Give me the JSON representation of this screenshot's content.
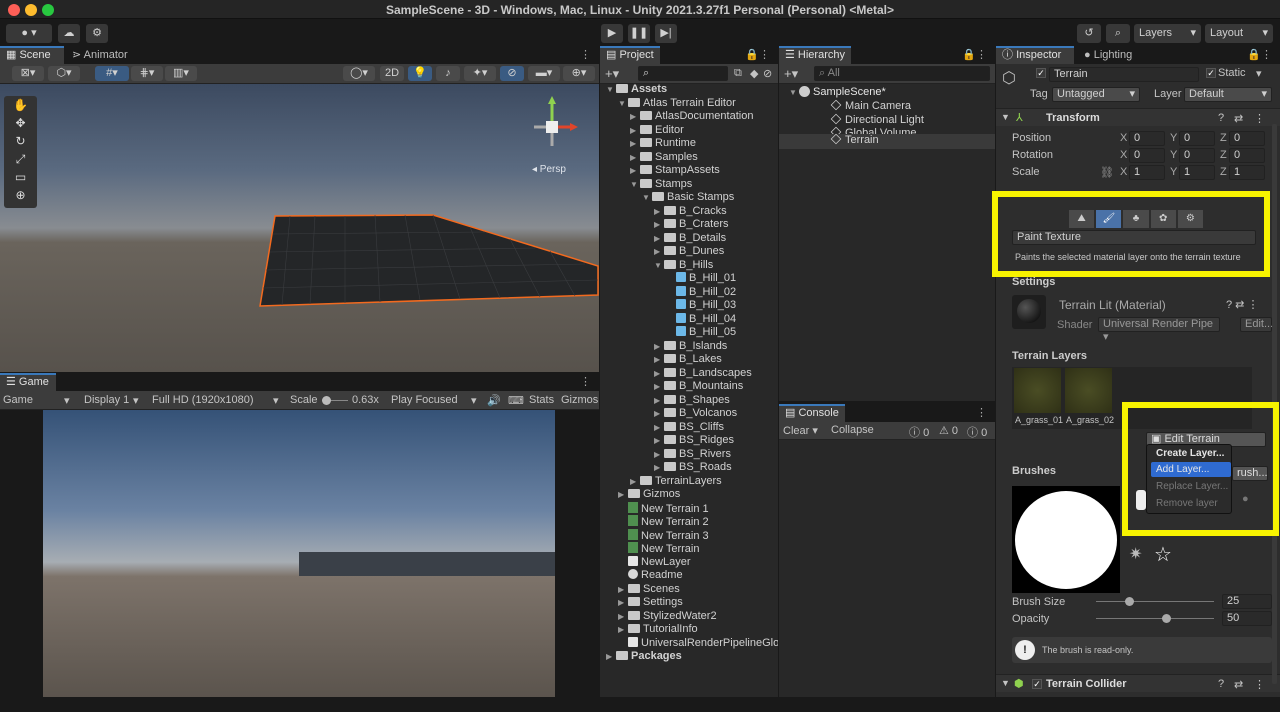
{
  "window_title": "SampleScene - 3D - Windows, Mac, Linux - Unity 2021.3.27f1 Personal (Personal) <Metal>",
  "toolbar": {
    "layers": "Layers",
    "layout": "Layout"
  },
  "scene": {
    "tabs": [
      "Scene",
      "Animator"
    ],
    "mode_2d": "2D",
    "persp": "◂ Persp"
  },
  "game": {
    "tab": "Game",
    "display_mode": "Game",
    "display": "Display 1",
    "resolution": "Full HD (1920x1080)",
    "scale_label": "Scale",
    "scale_value": "0.63x",
    "play_mode": "Play Focused",
    "stats": "Stats",
    "gizmos": "Gizmos"
  },
  "project": {
    "tab": "Project",
    "tree": [
      {
        "t": "Assets",
        "d": 0,
        "k": "folder",
        "b": true,
        "exp": true
      },
      {
        "t": "Atlas Terrain Editor",
        "d": 1,
        "k": "folder",
        "exp": true
      },
      {
        "t": "AtlasDocumentation",
        "d": 2,
        "k": "folder",
        "exp": false
      },
      {
        "t": "Editor",
        "d": 2,
        "k": "folder",
        "exp": false
      },
      {
        "t": "Runtime",
        "d": 2,
        "k": "folder",
        "exp": false
      },
      {
        "t": "Samples",
        "d": 2,
        "k": "folder",
        "exp": false
      },
      {
        "t": "StampAssets",
        "d": 2,
        "k": "folder",
        "exp": false
      },
      {
        "t": "Stamps",
        "d": 2,
        "k": "folder",
        "exp": true
      },
      {
        "t": "Basic Stamps",
        "d": 3,
        "k": "folder",
        "exp": true
      },
      {
        "t": "B_Cracks",
        "d": 4,
        "k": "folder",
        "exp": false
      },
      {
        "t": "B_Craters",
        "d": 4,
        "k": "folder",
        "exp": false
      },
      {
        "t": "B_Details",
        "d": 4,
        "k": "folder",
        "exp": false
      },
      {
        "t": "B_Dunes",
        "d": 4,
        "k": "folder",
        "exp": false
      },
      {
        "t": "B_Hills",
        "d": 4,
        "k": "folder",
        "exp": true
      },
      {
        "t": "B_Hill_01",
        "d": 5,
        "k": "cube"
      },
      {
        "t": "B_Hill_02",
        "d": 5,
        "k": "cube"
      },
      {
        "t": "B_Hill_03",
        "d": 5,
        "k": "cube"
      },
      {
        "t": "B_Hill_04",
        "d": 5,
        "k": "cube"
      },
      {
        "t": "B_Hill_05",
        "d": 5,
        "k": "cube"
      },
      {
        "t": "B_Islands",
        "d": 4,
        "k": "folder",
        "exp": false
      },
      {
        "t": "B_Lakes",
        "d": 4,
        "k": "folder",
        "exp": false
      },
      {
        "t": "B_Landscapes",
        "d": 4,
        "k": "folder",
        "exp": false
      },
      {
        "t": "B_Mountains",
        "d": 4,
        "k": "folder",
        "exp": false
      },
      {
        "t": "B_Shapes",
        "d": 4,
        "k": "folder",
        "exp": false
      },
      {
        "t": "B_Volcanos",
        "d": 4,
        "k": "folder",
        "exp": false
      },
      {
        "t": "BS_Cliffs",
        "d": 4,
        "k": "folder",
        "exp": false
      },
      {
        "t": "BS_Ridges",
        "d": 4,
        "k": "folder",
        "exp": false
      },
      {
        "t": "BS_Rivers",
        "d": 4,
        "k": "folder",
        "exp": false
      },
      {
        "t": "BS_Roads",
        "d": 4,
        "k": "folder",
        "exp": false
      },
      {
        "t": "TerrainLayers",
        "d": 2,
        "k": "folder",
        "exp": false
      },
      {
        "t": "Gizmos",
        "d": 1,
        "k": "folder",
        "exp": false
      },
      {
        "t": "New Terrain 1",
        "d": 1,
        "k": "script"
      },
      {
        "t": "New Terrain 2",
        "d": 1,
        "k": "script"
      },
      {
        "t": "New Terrain 3",
        "d": 1,
        "k": "script"
      },
      {
        "t": "New Terrain",
        "d": 1,
        "k": "script"
      },
      {
        "t": "NewLayer",
        "d": 1,
        "k": "file"
      },
      {
        "t": "Readme",
        "d": 1,
        "k": "readme"
      },
      {
        "t": "Scenes",
        "d": 1,
        "k": "folder",
        "exp": false
      },
      {
        "t": "Settings",
        "d": 1,
        "k": "folder",
        "exp": false
      },
      {
        "t": "StylizedWater2",
        "d": 1,
        "k": "folder",
        "exp": false
      },
      {
        "t": "TutorialInfo",
        "d": 1,
        "k": "folder",
        "exp": false
      },
      {
        "t": "UniversalRenderPipelineGlob",
        "d": 1,
        "k": "asset"
      },
      {
        "t": "Packages",
        "d": 0,
        "k": "folder",
        "b": true,
        "exp": false
      }
    ]
  },
  "hierarchy": {
    "tab": "Hierarchy",
    "search_placeholder": "All",
    "scene": "SampleScene*",
    "items": [
      "Main Camera",
      "Directional Light",
      "Global Volume",
      "Terrain"
    ]
  },
  "console": {
    "tab": "Console",
    "clear": "Clear",
    "collapse": "Collapse",
    "errors": "0",
    "warnings": "0",
    "logs": "0"
  },
  "inspector": {
    "tabs": [
      "Inspector",
      "Lighting"
    ],
    "object_name": "Terrain",
    "static_label": "Static",
    "tag_label": "Tag",
    "tag_value": "Untagged",
    "layer_label": "Layer",
    "layer_value": "Default",
    "transform": {
      "title": "Transform",
      "position": {
        "label": "Position",
        "x": "0",
        "y": "0",
        "z": "0"
      },
      "rotation": {
        "label": "Rotation",
        "x": "0",
        "y": "0",
        "z": "0"
      },
      "scale": {
        "label": "Scale",
        "x": "1",
        "y": "1",
        "z": "1"
      }
    },
    "tool_name": "Paint Texture",
    "tool_desc": "Paints the selected material layer onto the terrain texture",
    "settings_label": "Settings",
    "material_name": "Terrain Lit (Material)",
    "shader_label": "Shader",
    "shader_value": "Universal Render Pipe",
    "edit_label": "Edit...",
    "terrain_layers_label": "Terrain Layers",
    "layers": [
      "A_grass_01",
      "A_grass_02"
    ],
    "edit_layers_btn": "Edit Terrain Layers...",
    "menu": [
      "Create Layer...",
      "Add Layer...",
      "Replace Layer...",
      "Remove layer"
    ],
    "brushes_label": "Brushes",
    "brush_btn": "rush...",
    "brush_size_label": "Brush Size",
    "brush_size": "25",
    "opacity_label": "Opacity",
    "opacity": "50",
    "readonly_msg": "The brush is read-only.",
    "collider": "Terrain Collider"
  },
  "colors": {
    "highlight": "#f7f300",
    "accent": "#3a79bb",
    "selection_outline": "#f26a1f"
  }
}
